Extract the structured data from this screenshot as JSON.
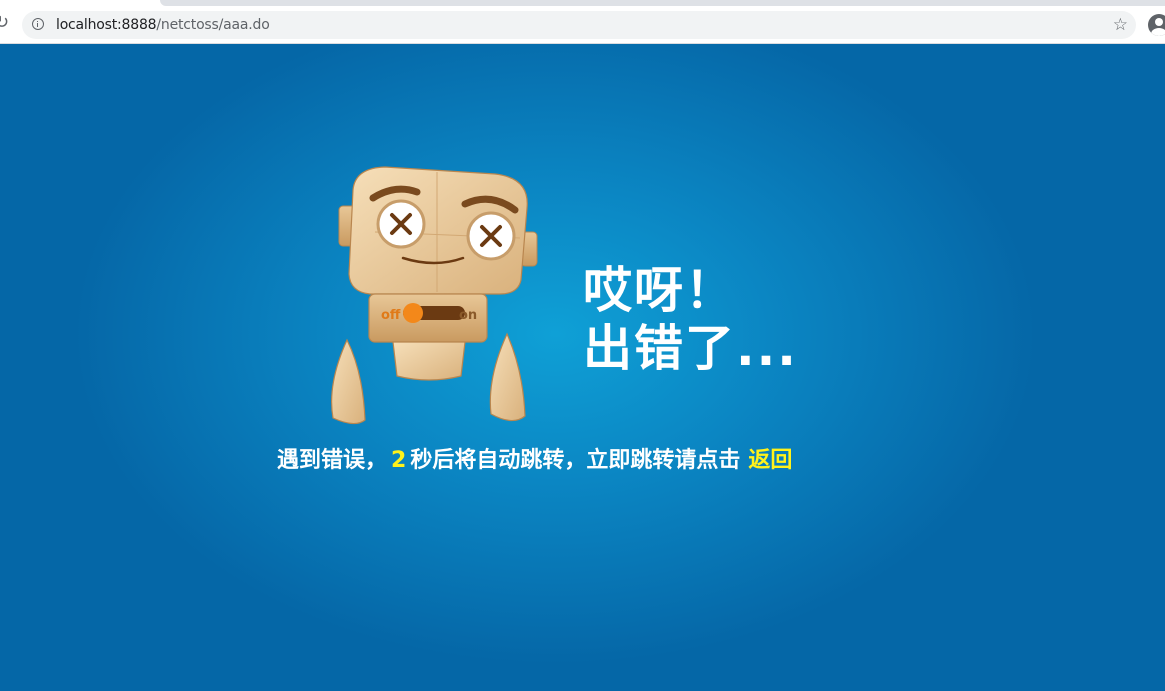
{
  "browser": {
    "url_host": "localhost:8888",
    "url_path": "/netctoss/aaa.do"
  },
  "robot": {
    "switch_off_label": "off",
    "switch_on_label": "on"
  },
  "error": {
    "line1": "哎呀！",
    "line2": "出错了...",
    "message_prefix": "遇到错误，",
    "countdown_seconds": "2",
    "message_suffix": "秒后将自动跳转，立即跳转请点击",
    "back_link_label": "返回"
  },
  "colors": {
    "background_center": "#0fa0d6",
    "background_edge": "#0567a7",
    "headline": "#ffffff",
    "highlight": "#fff21a"
  }
}
